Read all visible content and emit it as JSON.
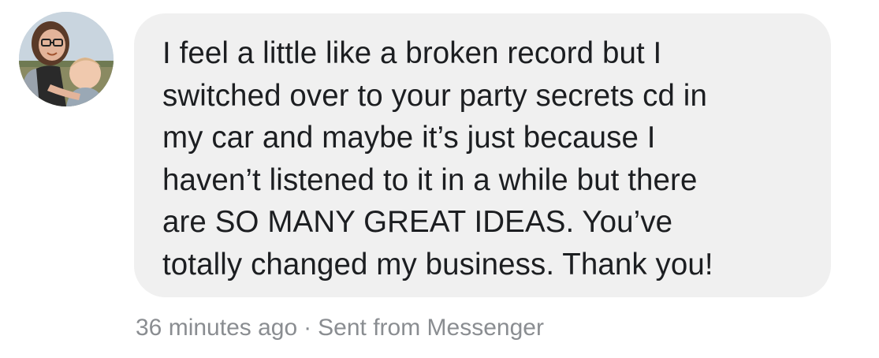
{
  "comment": {
    "avatar_icon": "profile-photo",
    "message_lines": [
      "I feel a little like a broken record but I",
      "switched over to your party secrets cd in",
      "my car and maybe it’s just because I",
      "haven’t listened to it in a while but there",
      "are SO MANY GREAT IDEAS. You’ve",
      "totally changed my business. Thank you!"
    ],
    "timestamp": "36 minutes ago",
    "separator": "·",
    "source": "Sent from Messenger"
  },
  "colors": {
    "bubble_background": "#f0f0f0",
    "message_text": "#1c1e21",
    "meta_text": "#8a8d91"
  }
}
